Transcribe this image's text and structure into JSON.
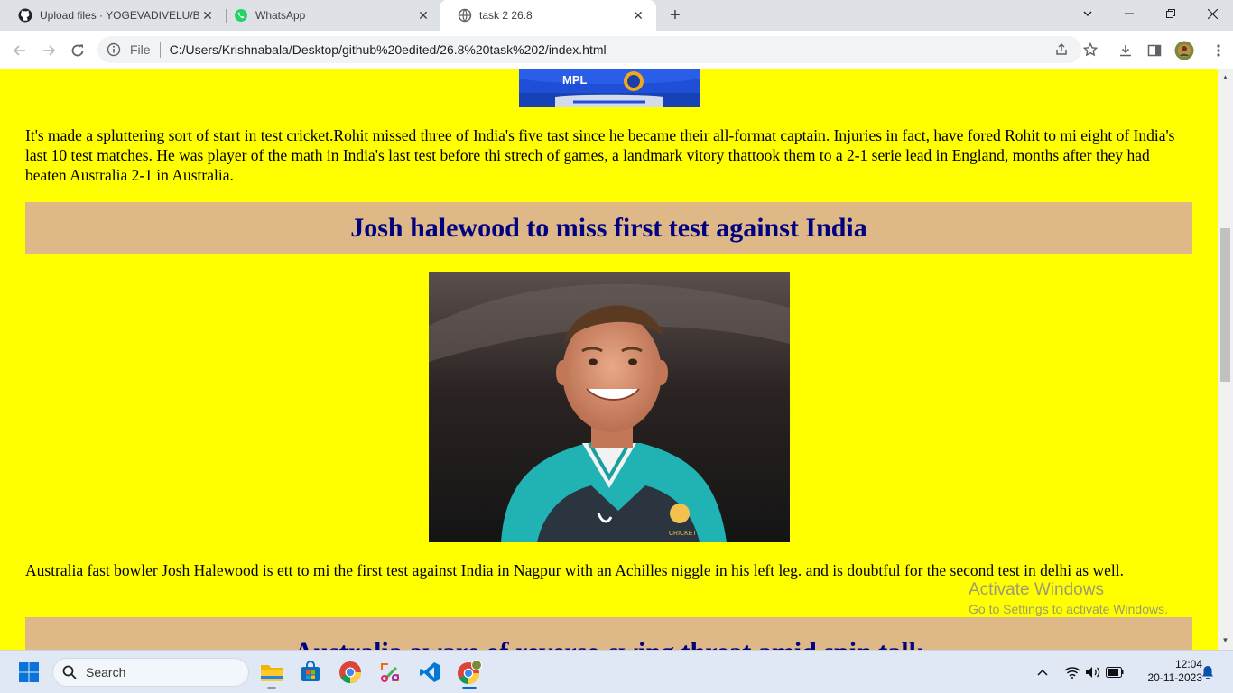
{
  "browser": {
    "tabs": [
      {
        "title": "Upload files · YOGEVADIVELU/Ba",
        "icon": "github-icon",
        "active": false
      },
      {
        "title": "WhatsApp",
        "icon": "whatsapp-icon",
        "active": false
      },
      {
        "title": "task 2 26.8",
        "icon": "globe-icon",
        "active": true
      }
    ],
    "scheme_label": "File",
    "url": "C:/Users/Krishnabala/Desktop/github%20edited/26.8%20task%202/index.html"
  },
  "page": {
    "paragraph_rohit": "It's made a spluttering sort of start in test cricket.Rohit missed three of India's five tast since he became their all-format captain. Injuries in fact, have fored Rohit to mi eight of India's last 10 test matches. He was player of the math in India's last test before thi strech of games, a landmark vitory thattook them to a 2-1 serie lead in England, months after they had beaten Australia 2-1 in Australia.",
    "heading_hazlewood": "Josh halewood to miss first test against India",
    "paragraph_hazlewood": "Australia fast bowler Josh Halewood is ett to mi the first test against India in Nagpur with an Achilles niggle in his left leg. and is doubtful for the second test in delhi as well.",
    "heading_reverse_swing": "Australia aware of reverse-swing threat amid spin talk",
    "photo_top_text": "MPL",
    "photo_bottom_text": "CRICKET"
  },
  "watermark": {
    "line1": "Activate Windows",
    "line2": "Go to Settings to activate Windows."
  },
  "taskbar": {
    "search_placeholder": "Search",
    "time": "12:04",
    "date": "20-11-2023"
  },
  "colors": {
    "page_background": "#ffff00",
    "heading_background": "#deb887",
    "heading_text": "#000080"
  }
}
